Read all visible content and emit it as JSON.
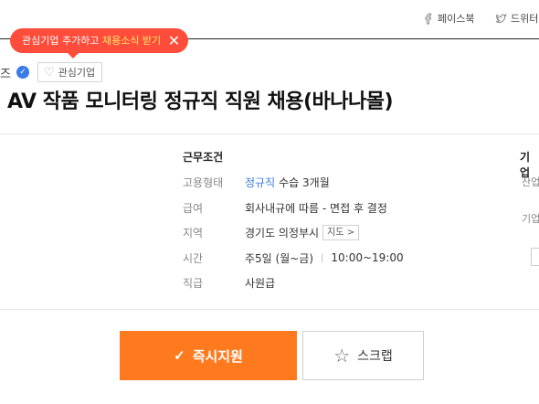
{
  "share": {
    "facebook": "페이스북",
    "twitter": "드위터"
  },
  "tooltip": {
    "text_prefix": "관심기업 추가하고 ",
    "text_highlight": "채용소식 받기",
    "close": "✕"
  },
  "company": {
    "name_fragment": "즈",
    "favorite_label": "관심기업"
  },
  "job_title": "AV 작품 모니터링 정규직 직원 채용(바나나몰)",
  "conditions": {
    "title": "근무조건",
    "employment_label": "고용형태",
    "employment_type": "정규직",
    "employment_probation": "수습 3개월",
    "salary_label": "급여",
    "salary": "회사내규에 따름 - 면접 후 결정",
    "region_label": "지역",
    "region": "경기도 의정부시",
    "map_button": "지도 >",
    "hours_label": "시간",
    "days": "주5일 (월~금)",
    "hours": "10:00~19:00",
    "position_label": "직급",
    "position": "사원급"
  },
  "company_info": {
    "title_fragment": "기업",
    "row1_fragment": "산업",
    "row2_fragment": "기업"
  },
  "actions": {
    "apply": "즉시지원",
    "scrap": "스크랩"
  },
  "colors": {
    "accent_orange": "#ff7a1f",
    "tooltip_red": "#ff4c3b",
    "link_blue": "#3a7be8"
  }
}
